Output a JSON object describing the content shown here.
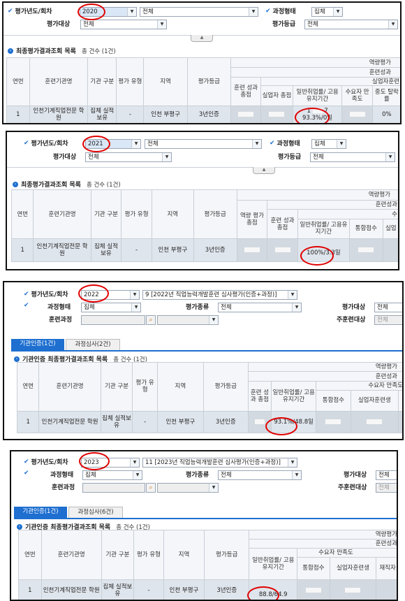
{
  "labels": {
    "year": "평가년도/회차",
    "course_type": "과정형태",
    "target": "평가대상",
    "grade": "평가등급",
    "kind": "평가종류",
    "training_course": "훈련과정",
    "main_target": "주훈련대상",
    "list_title": "최종평가결과조회 목록",
    "list_title_cert": "기관인증 최종평가결과조회 목록",
    "count": "총 건수 (1건)"
  },
  "common": {
    "all": "전체",
    "group": "집체"
  },
  "headers": {
    "no": "연번",
    "org": "훈련기관명",
    "org_type": "기관 구분",
    "eval_type": "평가 유형",
    "region": "지역",
    "eval_grade": "평가등급",
    "capacity": "역량평가",
    "training_result": "훈련성과",
    "unemployed": "실업자훈련",
    "training_score": "훈련 성과 총점",
    "capacity_score": "역량 평가 총점",
    "unemployed_score": "실업자 총점",
    "employ_rate": "일반취업률/ 고용유지기간",
    "satisfaction": "수요자 만족도",
    "dropout": "중도 탈락률",
    "total_score": "통합점수",
    "unemployed_trainee": "실업자훈련생",
    "employed_trainee": "재직자"
  },
  "row": {
    "no": "1",
    "org": "인천기계직업전문 학원",
    "org_type": "집체 실적보유",
    "eval_type": "-",
    "region": "인천 부평구",
    "grade": "3년인증"
  },
  "panel2020": {
    "year": "2020",
    "employ_top": "1",
    "employ_top2": "7",
    "employ_bottom": "93.3%/",
    "employ_bottom2": "0일",
    "dropout": "0%"
  },
  "panel2021": {
    "year": "2021",
    "employ": "100%/",
    "employ2": "3.3일"
  },
  "panel2022": {
    "year": "2022",
    "round": "9 [2022년 직업능력개발훈련 심사평가(인증+과정)]",
    "tab_cert": "기관인증(1건)",
    "tab_course": "과정심사(2건)",
    "employ": "93.1%/",
    "employ2": "48.8일"
  },
  "panel2023": {
    "year": "2023",
    "round": "11 [2023년 직업능력개발훈련 심사평가(인증+과정)]",
    "tab_cert": "기관인증(1건)",
    "tab_course": "과정심사(6건)",
    "employ": "88.8/",
    "employ2": "64.9"
  }
}
